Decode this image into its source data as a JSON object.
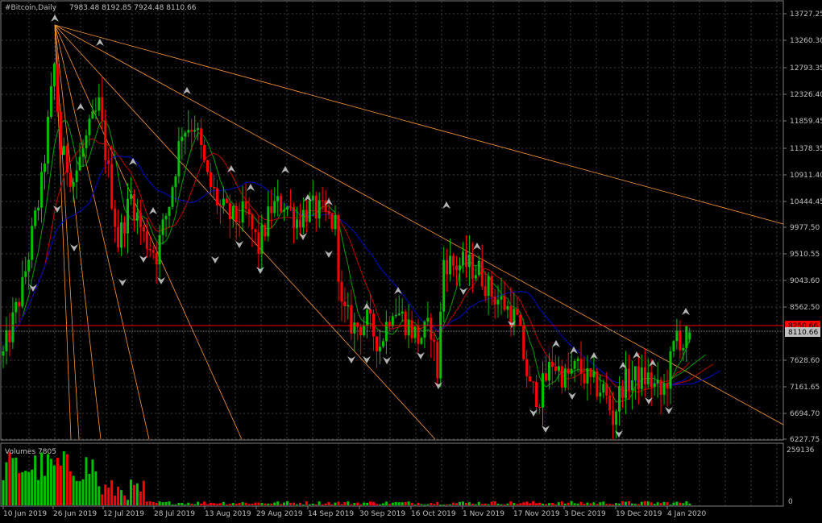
{
  "chart_header": {
    "symbol_text": "#Bitcoin,Daily",
    "ohlc_text": "7983.48 8192.85 7924.48 8110.66"
  },
  "volume_header": {
    "text": "Volumes 7805"
  },
  "price_axis": {
    "ticks": [
      "13727.25",
      "13260.30",
      "12793.35",
      "12326.40",
      "11859.45",
      "11378.35",
      "10911.40",
      "10444.45",
      "9977.50",
      "9510.55",
      "9043.60",
      "8562.50",
      "7628.60",
      "7161.65",
      "6694.70",
      "6227.75"
    ],
    "ask_label": "8250.66",
    "bid_label": "8110.66"
  },
  "volume_axis": {
    "max_label": "259136",
    "min_label": "0"
  },
  "time_axis": {
    "labels": [
      "10 Jun 2019",
      "26 Jun 2019",
      "12 Jul 2019",
      "28 Jul 2019",
      "13 Aug 2019",
      "29 Aug 2019",
      "14 Sep 2019",
      "30 Sep 2019",
      "16 Oct 2019",
      "1 Nov 2019",
      "17 Nov 2019",
      "3 Dec 2019",
      "19 Dec 2019",
      "4 Jan 2020"
    ]
  },
  "colors": {
    "background": "#000000",
    "grid": "#3c3c3c",
    "bull": "#00c000",
    "bear": "#ff0000",
    "ma_fast": "#00a000",
    "ma_mid": "#c00000",
    "ma_slow": "#0000c8",
    "trendline": "#ff9933",
    "ask_line": "#ff0000",
    "bid_line": "#808080"
  },
  "chart_data": {
    "type": "candlestick",
    "symbol": "#Bitcoin",
    "timeframe": "Daily",
    "last": {
      "open": 7983.48,
      "high": 8192.85,
      "low": 7924.48,
      "close": 8110.66
    },
    "ylim": [
      6227.75,
      13727.25
    ],
    "volume_last": 7805,
    "volume_max": 259136,
    "close_path": [
      [
        "10 Jun 2019",
        7700
      ],
      [
        "16 Jun 2019",
        8900
      ],
      [
        "22 Jun 2019",
        10700
      ],
      [
        "26 Jun 2019",
        12800
      ],
      [
        "28 Jun 2019",
        11300
      ],
      [
        "2 Jul 2019",
        10800
      ],
      [
        "6 Jul 2019",
        11500
      ],
      [
        "10 Jul 2019",
        12100
      ],
      [
        "12 Jul 2019",
        11300
      ],
      [
        "16 Jul 2019",
        9700
      ],
      [
        "20 Jul 2019",
        10500
      ],
      [
        "24 Jul 2019",
        9800
      ],
      [
        "28 Jul 2019",
        9500
      ],
      [
        "1 Aug 2019",
        10400
      ],
      [
        "5 Aug 2019",
        11700
      ],
      [
        "9 Aug 2019",
        11800
      ],
      [
        "13 Aug 2019",
        10800
      ],
      [
        "17 Aug 2019",
        10300
      ],
      [
        "21 Aug 2019",
        10100
      ],
      [
        "25 Aug 2019",
        10200
      ],
      [
        "29 Aug 2019",
        9600
      ],
      [
        "2 Sep 2019",
        10300
      ],
      [
        "6 Sep 2019",
        10400
      ],
      [
        "10 Sep 2019",
        10100
      ],
      [
        "14 Sep 2019",
        10300
      ],
      [
        "18 Sep 2019",
        10200
      ],
      [
        "22 Sep 2019",
        10000
      ],
      [
        "24 Sep 2019",
        8500
      ],
      [
        "28 Sep 2019",
        8200
      ],
      [
        "2 Oct 2019",
        8300
      ],
      [
        "6 Oct 2019",
        7900
      ],
      [
        "10 Oct 2019",
        8600
      ],
      [
        "14 Oct 2019",
        8300
      ],
      [
        "18 Oct 2019",
        8000
      ],
      [
        "22 Oct 2019",
        8200
      ],
      [
        "24 Oct 2019",
        7400
      ],
      [
        "26 Oct 2019",
        9400
      ],
      [
        "29 Oct 2019",
        9300
      ],
      [
        "2 Nov 2019",
        9300
      ],
      [
        "6 Nov 2019",
        9200
      ],
      [
        "10 Nov 2019",
        8800
      ],
      [
        "14 Nov 2019",
        8600
      ],
      [
        "18 Nov 2019",
        8300
      ],
      [
        "22 Nov 2019",
        7100
      ],
      [
        "25 Nov 2019",
        7000
      ],
      [
        "29 Nov 2019",
        7600
      ],
      [
        "3 Dec 2019",
        7300
      ],
      [
        "7 Dec 2019",
        7500
      ],
      [
        "11 Dec 2019",
        7200
      ],
      [
        "15 Dec 2019",
        7100
      ],
      [
        "18 Dec 2019",
        6600
      ],
      [
        "21 Dec 2019",
        7200
      ],
      [
        "25 Dec 2019",
        7300
      ],
      [
        "29 Dec 2019",
        7300
      ],
      [
        "2 Jan 2020",
        7000
      ],
      [
        "4 Jan 2020",
        7300
      ],
      [
        "7 Jan 2020",
        8100
      ],
      [
        "9 Jan 2020",
        7900
      ],
      [
        "11 Jan 2020",
        8110.66
      ]
    ]
  }
}
